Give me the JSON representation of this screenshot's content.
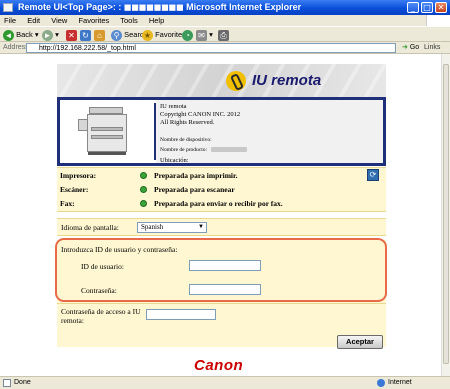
{
  "window": {
    "title": "Remote UI<Top Page>: :  ◼◼◼◼◼◼◼◼ Microsoft Internet Explorer",
    "minimize_glyph": "_",
    "maximize_glyph": "□",
    "close_glyph": "✕"
  },
  "menubar": {
    "items": [
      "File",
      "Edit",
      "View",
      "Favorites",
      "Tools",
      "Help"
    ]
  },
  "toolbar": {
    "back_label": "Back",
    "search_label": "Search",
    "favorites_label": "Favorites"
  },
  "address": {
    "label": "Address",
    "url": "http://192.168.222.58/_top.html",
    "go_label": "Go",
    "links_label": "Links"
  },
  "header": {
    "brand": "IU remota"
  },
  "device": {
    "product_name": "IU remota",
    "copyright": "Copyright CANON INC. 2012",
    "rights": "All Rights Reserved.",
    "device_name_label": "Nombre de dispositivo:",
    "product_label": "Nombre de producto:",
    "location_label": "Ubicación:"
  },
  "status": {
    "rows": [
      {
        "label": "Impresora:",
        "text": "Preparada para imprimir."
      },
      {
        "label": "Escáner:",
        "text": "Preparada para escanear"
      },
      {
        "label": "Fax:",
        "text": "Preparada para enviar o recibir por fax."
      }
    ],
    "refresh_glyph": "⟳"
  },
  "language": {
    "label": "Idioma de pantalla:",
    "selected": "Spanish"
  },
  "login": {
    "intro": "Introduzca ID de usuario y contraseña:",
    "user_id_label": "ID de usuario:",
    "password_label": "Contraseña:"
  },
  "remote_password": {
    "label": "Contraseña de acceso a IU remota:"
  },
  "buttons": {
    "accept": "Aceptar"
  },
  "footer": {
    "brand": "Canon"
  },
  "statusbar": {
    "done": "Done",
    "zone": "Internet"
  },
  "colors": {
    "title_blue": "#0a4fd8",
    "panel_yellow": "#fff7d1",
    "border_navy": "#1f2f7a",
    "highlight": "#e86a48",
    "canon_red": "#cc0000",
    "status_green": "#3aa33a"
  }
}
